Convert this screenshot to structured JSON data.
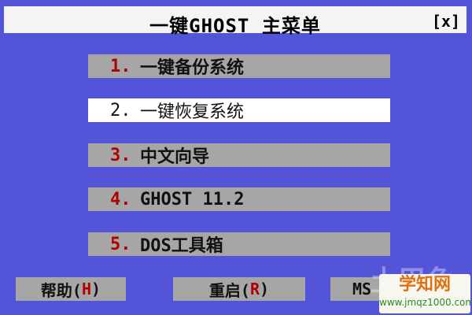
{
  "window": {
    "title": "一键GHOST 主菜单",
    "close_label": "[x]"
  },
  "menu": [
    {
      "num": "1.",
      "label": "一键备份系统",
      "selected": false
    },
    {
      "num": "2.",
      "label": "一键恢复系统",
      "selected": true
    },
    {
      "num": "3.",
      "label": "中文向导",
      "selected": false
    },
    {
      "num": "4.",
      "label": "GHOST 11.2",
      "selected": false
    },
    {
      "num": "5.",
      "label": "DOS工具箱",
      "selected": false
    }
  ],
  "buttons": {
    "help": {
      "text": "帮助(",
      "key": "H",
      "close": ")"
    },
    "restart": {
      "text": "重启(",
      "key": "R",
      "close": ")"
    },
    "ms": {
      "text": "MS",
      "key": "",
      "close": ""
    }
  },
  "watermark": {
    "faded_text": "土巴兔",
    "title": "学知网",
    "url": "www.jmqz1000.com"
  },
  "colors": {
    "background": "#5454d8",
    "menu_item": "#a6a6a6",
    "selected_item": "#ffffff",
    "hotkey": "#b00000"
  }
}
